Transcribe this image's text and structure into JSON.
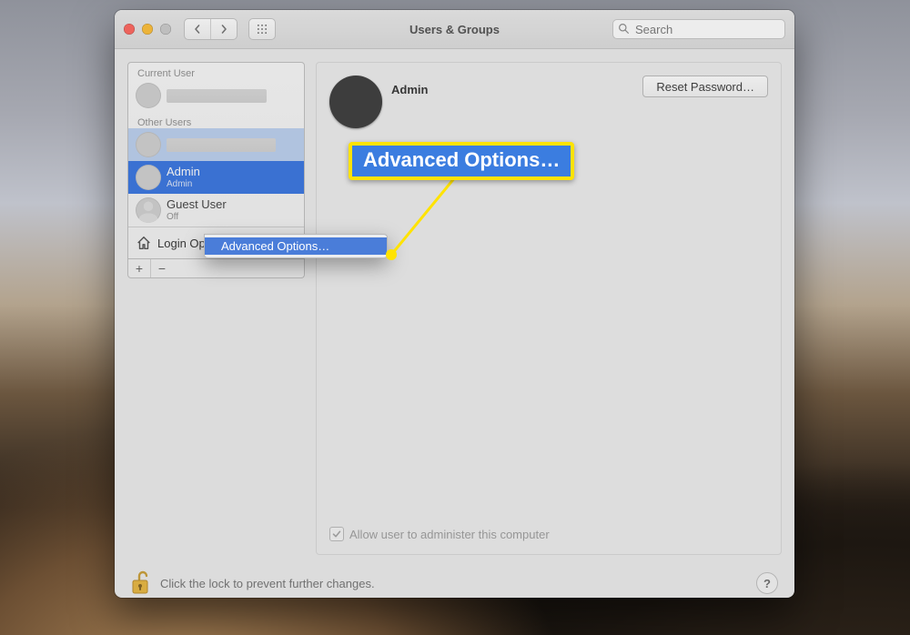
{
  "window": {
    "title": "Users & Groups"
  },
  "toolbar": {
    "search_placeholder": "Search"
  },
  "sidebar": {
    "section_current": "Current User",
    "section_other": "Other Users",
    "login_options": "Login Options",
    "add_glyph": "+",
    "remove_glyph": "−",
    "users": [
      {
        "name": "",
        "sub": ""
      },
      {
        "name": "",
        "sub": ""
      },
      {
        "name": "Admin",
        "sub": "Admin"
      },
      {
        "name": "Guest User",
        "sub": "Off"
      }
    ]
  },
  "main": {
    "user_name": "Admin",
    "reset_password": "Reset Password…",
    "admin_checkbox": "Allow user to administer this computer"
  },
  "context_menu": {
    "advanced_options": "Advanced Options…"
  },
  "callout": {
    "label": "Advanced Options…"
  },
  "footer": {
    "lock_text": "Click the lock to prevent further changes.",
    "help_glyph": "?"
  }
}
